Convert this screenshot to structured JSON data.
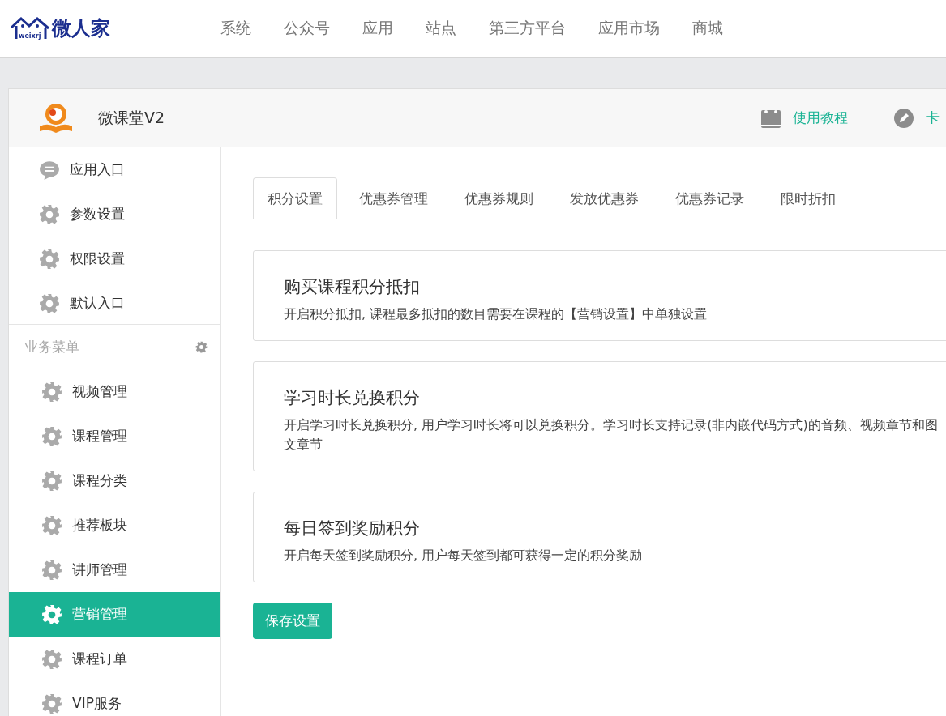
{
  "logo": {
    "text": "微人家",
    "sub": "weixrj"
  },
  "nav": [
    {
      "label": "系统"
    },
    {
      "label": "公众号"
    },
    {
      "label": "应用"
    },
    {
      "label": "站点"
    },
    {
      "label": "第三方平台"
    },
    {
      "label": "应用市场"
    },
    {
      "label": "商城"
    }
  ],
  "app": {
    "name": "微课堂V2",
    "links": [
      {
        "label": "使用教程",
        "kind": "book"
      },
      {
        "label": "卡",
        "kind": "edit"
      }
    ]
  },
  "sidebar": {
    "top_items": [
      {
        "label": "应用入口",
        "kind": "chat",
        "selected": false
      },
      {
        "label": "参数设置",
        "kind": "gear",
        "selected": false
      },
      {
        "label": "权限设置",
        "kind": "gear",
        "selected": false
      },
      {
        "label": "默认入口",
        "kind": "gear",
        "selected": false
      }
    ],
    "section": "业务菜单",
    "items": [
      {
        "label": "视频管理",
        "selected": false
      },
      {
        "label": "课程管理",
        "selected": false
      },
      {
        "label": "课程分类",
        "selected": false
      },
      {
        "label": "推荐板块",
        "selected": false
      },
      {
        "label": "讲师管理",
        "selected": false
      },
      {
        "label": "营销管理",
        "selected": true
      },
      {
        "label": "课程订单",
        "selected": false
      },
      {
        "label": "VIP服务",
        "selected": false
      }
    ]
  },
  "tabs": [
    {
      "label": "积分设置",
      "selected": true
    },
    {
      "label": "优惠券管理",
      "selected": false
    },
    {
      "label": "优惠券规则",
      "selected": false
    },
    {
      "label": "发放优惠券",
      "selected": false
    },
    {
      "label": "优惠券记录",
      "selected": false
    },
    {
      "label": "限时折扣",
      "selected": false
    }
  ],
  "cards": [
    {
      "title": "购买课程积分抵扣",
      "description": "开启积分抵扣, 课程最多抵扣的数目需要在课程的【营销设置】中单独设置"
    },
    {
      "title": "学习时长兑换积分",
      "description": "开启学习时长兑换积分, 用户学习时长将可以兑换积分。学习时长支持记录(非内嵌代码方式)的音频、视频章节和图文章节"
    },
    {
      "title": "每日签到奖励积分",
      "description": "开启每天签到奖励积分, 用户每天签到都可获得一定的积分奖励"
    }
  ],
  "save_button": "保存设置"
}
